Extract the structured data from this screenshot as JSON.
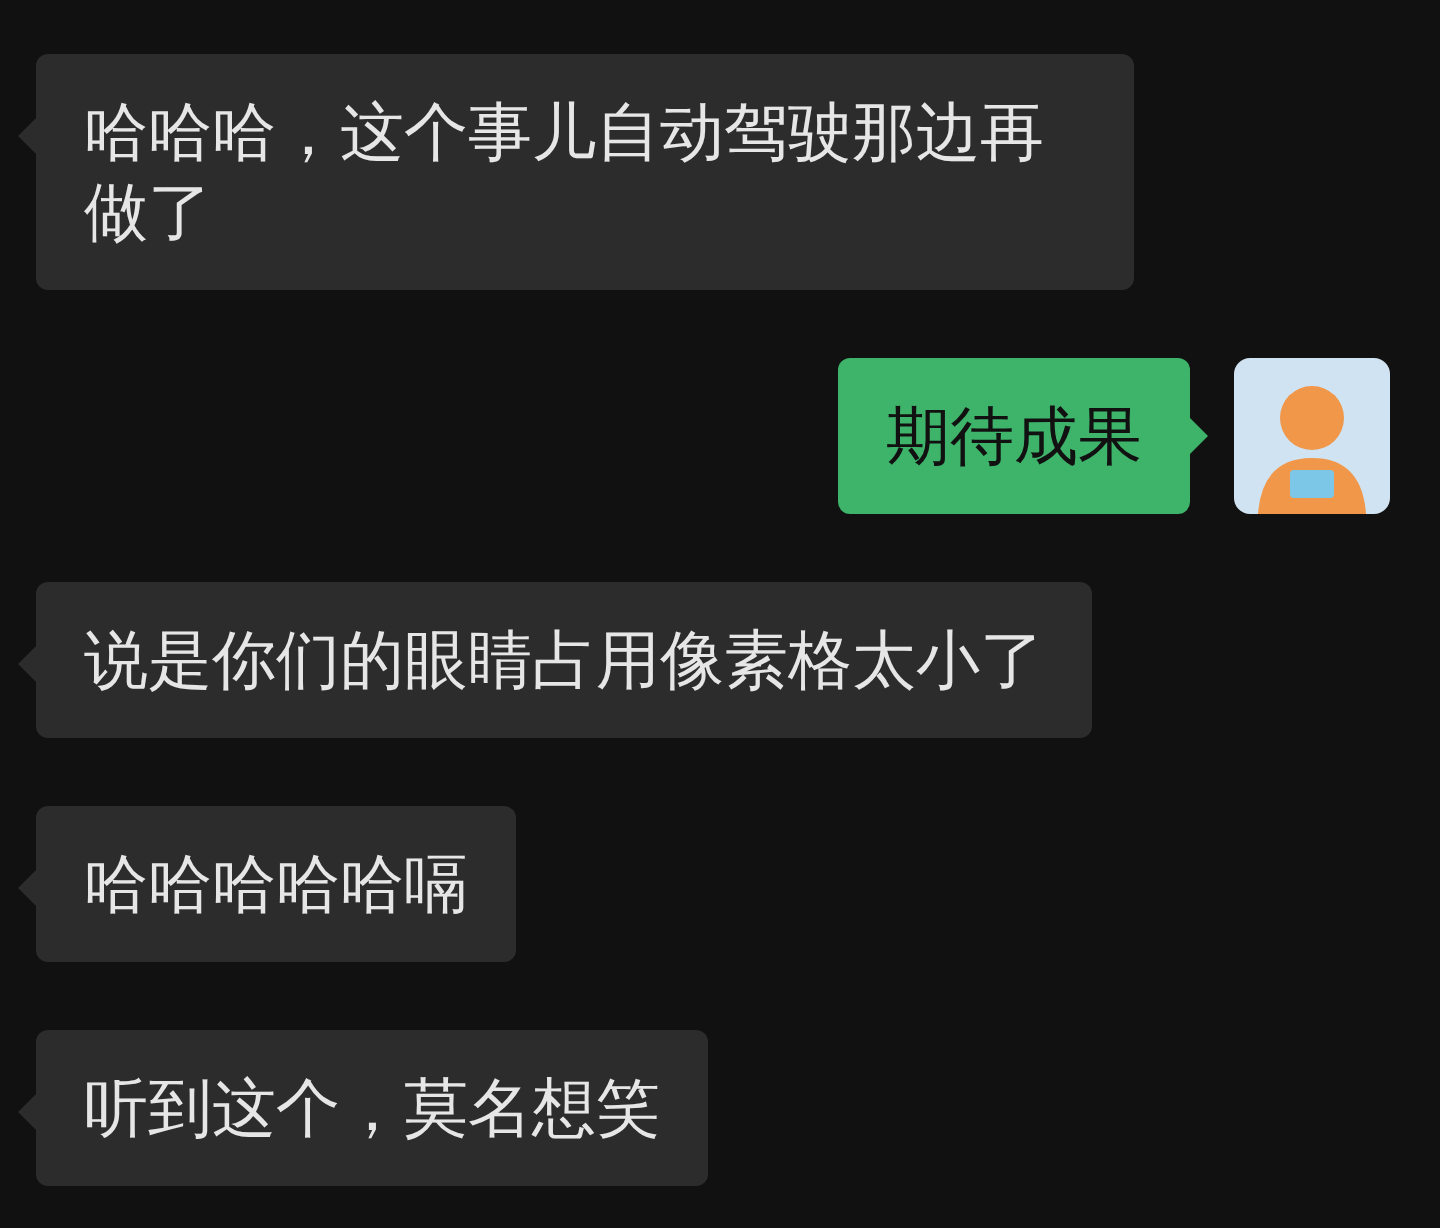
{
  "messages": [
    {
      "kind": "received",
      "text": "哈哈哈，这个事儿自动驾驶那边再做了"
    },
    {
      "kind": "sent",
      "text": "期待成果"
    },
    {
      "kind": "received",
      "text": "说是你们的眼睛占用像素格太小了"
    },
    {
      "kind": "received",
      "text": "哈哈哈哈哈嗝"
    },
    {
      "kind": "received",
      "text": "听到这个，莫名想笑"
    }
  ]
}
